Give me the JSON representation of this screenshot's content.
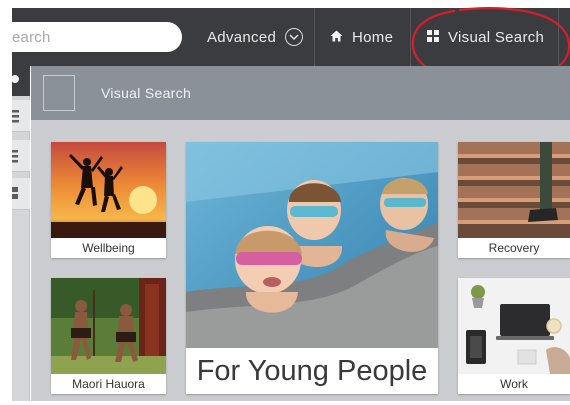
{
  "nav": {
    "search_placeholder": "earch",
    "advanced_label": "Advanced",
    "home_label": "Home",
    "visual_search_label": "Visual Search"
  },
  "subheader": {
    "title": "Visual Search"
  },
  "tiles": {
    "wellbeing": "Wellbeing",
    "young_people": "For Young People",
    "recovery": "Recovery",
    "maori_hauora": "Maori Hauora",
    "work": "Work"
  },
  "colors": {
    "nav_bg": "#3b3c40",
    "subheader_bg": "#8a9199",
    "content_bg": "#cbcdd0",
    "annotation": "#d81e28"
  }
}
